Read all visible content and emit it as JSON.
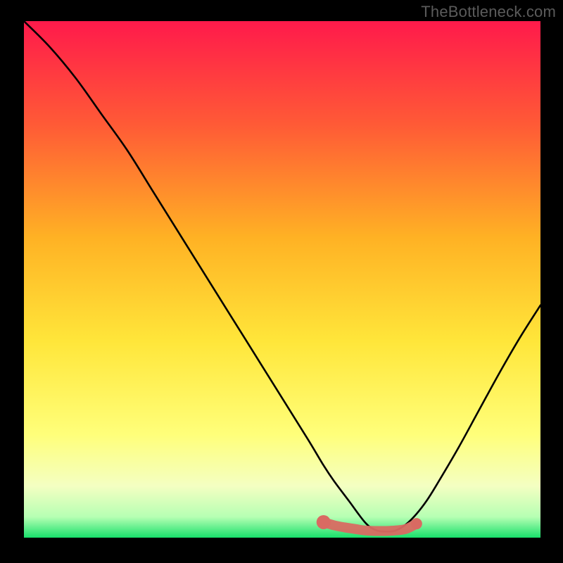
{
  "watermark": "TheBottleneck.com",
  "colors": {
    "background_black": "#000000",
    "gradient_top": "#ff1a4b",
    "gradient_mid1": "#ff6a2f",
    "gradient_mid2": "#ffd21f",
    "gradient_mid3": "#ffff66",
    "gradient_mid4": "#eaffb3",
    "gradient_bottom": "#18e06b",
    "curve_stroke": "#000000",
    "marker_fill": "#d96a62",
    "marker_stroke": "#b24b44"
  },
  "chart_data": {
    "type": "line",
    "title": "",
    "xlabel": "",
    "ylabel": "",
    "xlim": [
      0,
      100
    ],
    "ylim": [
      0,
      100
    ],
    "grid": false,
    "legend": false,
    "series": [
      {
        "name": "bottleneck-curve",
        "description": "V-shaped bottleneck percentage curve; minimum near x≈68 on a 0-100 horizontal scale, rising to ~100 at left edge and ~45 at right edge.",
        "x": [
          0,
          5,
          10,
          15,
          20,
          25,
          30,
          35,
          40,
          45,
          50,
          55,
          58,
          60,
          63,
          66,
          68,
          70,
          72,
          74,
          76,
          78,
          80,
          84,
          88,
          92,
          96,
          100
        ],
        "values": [
          100,
          95,
          89,
          82,
          75,
          67,
          59,
          51,
          43,
          35,
          27,
          19,
          14,
          11,
          7,
          3,
          1.5,
          1.2,
          1.4,
          2.6,
          4.6,
          7.2,
          10.4,
          17.2,
          24.5,
          31.8,
          38.7,
          45.0
        ]
      }
    ],
    "markers": {
      "name": "recommended-range",
      "description": "Flat highlighted segment at the valley floor indicating the optimal range.",
      "x": [
        58,
        60,
        62,
        64,
        66,
        68,
        70,
        72,
        74,
        76
      ],
      "values": [
        3.0,
        2.4,
        2.0,
        1.7,
        1.4,
        1.3,
        1.3,
        1.4,
        1.7,
        2.7
      ]
    }
  }
}
